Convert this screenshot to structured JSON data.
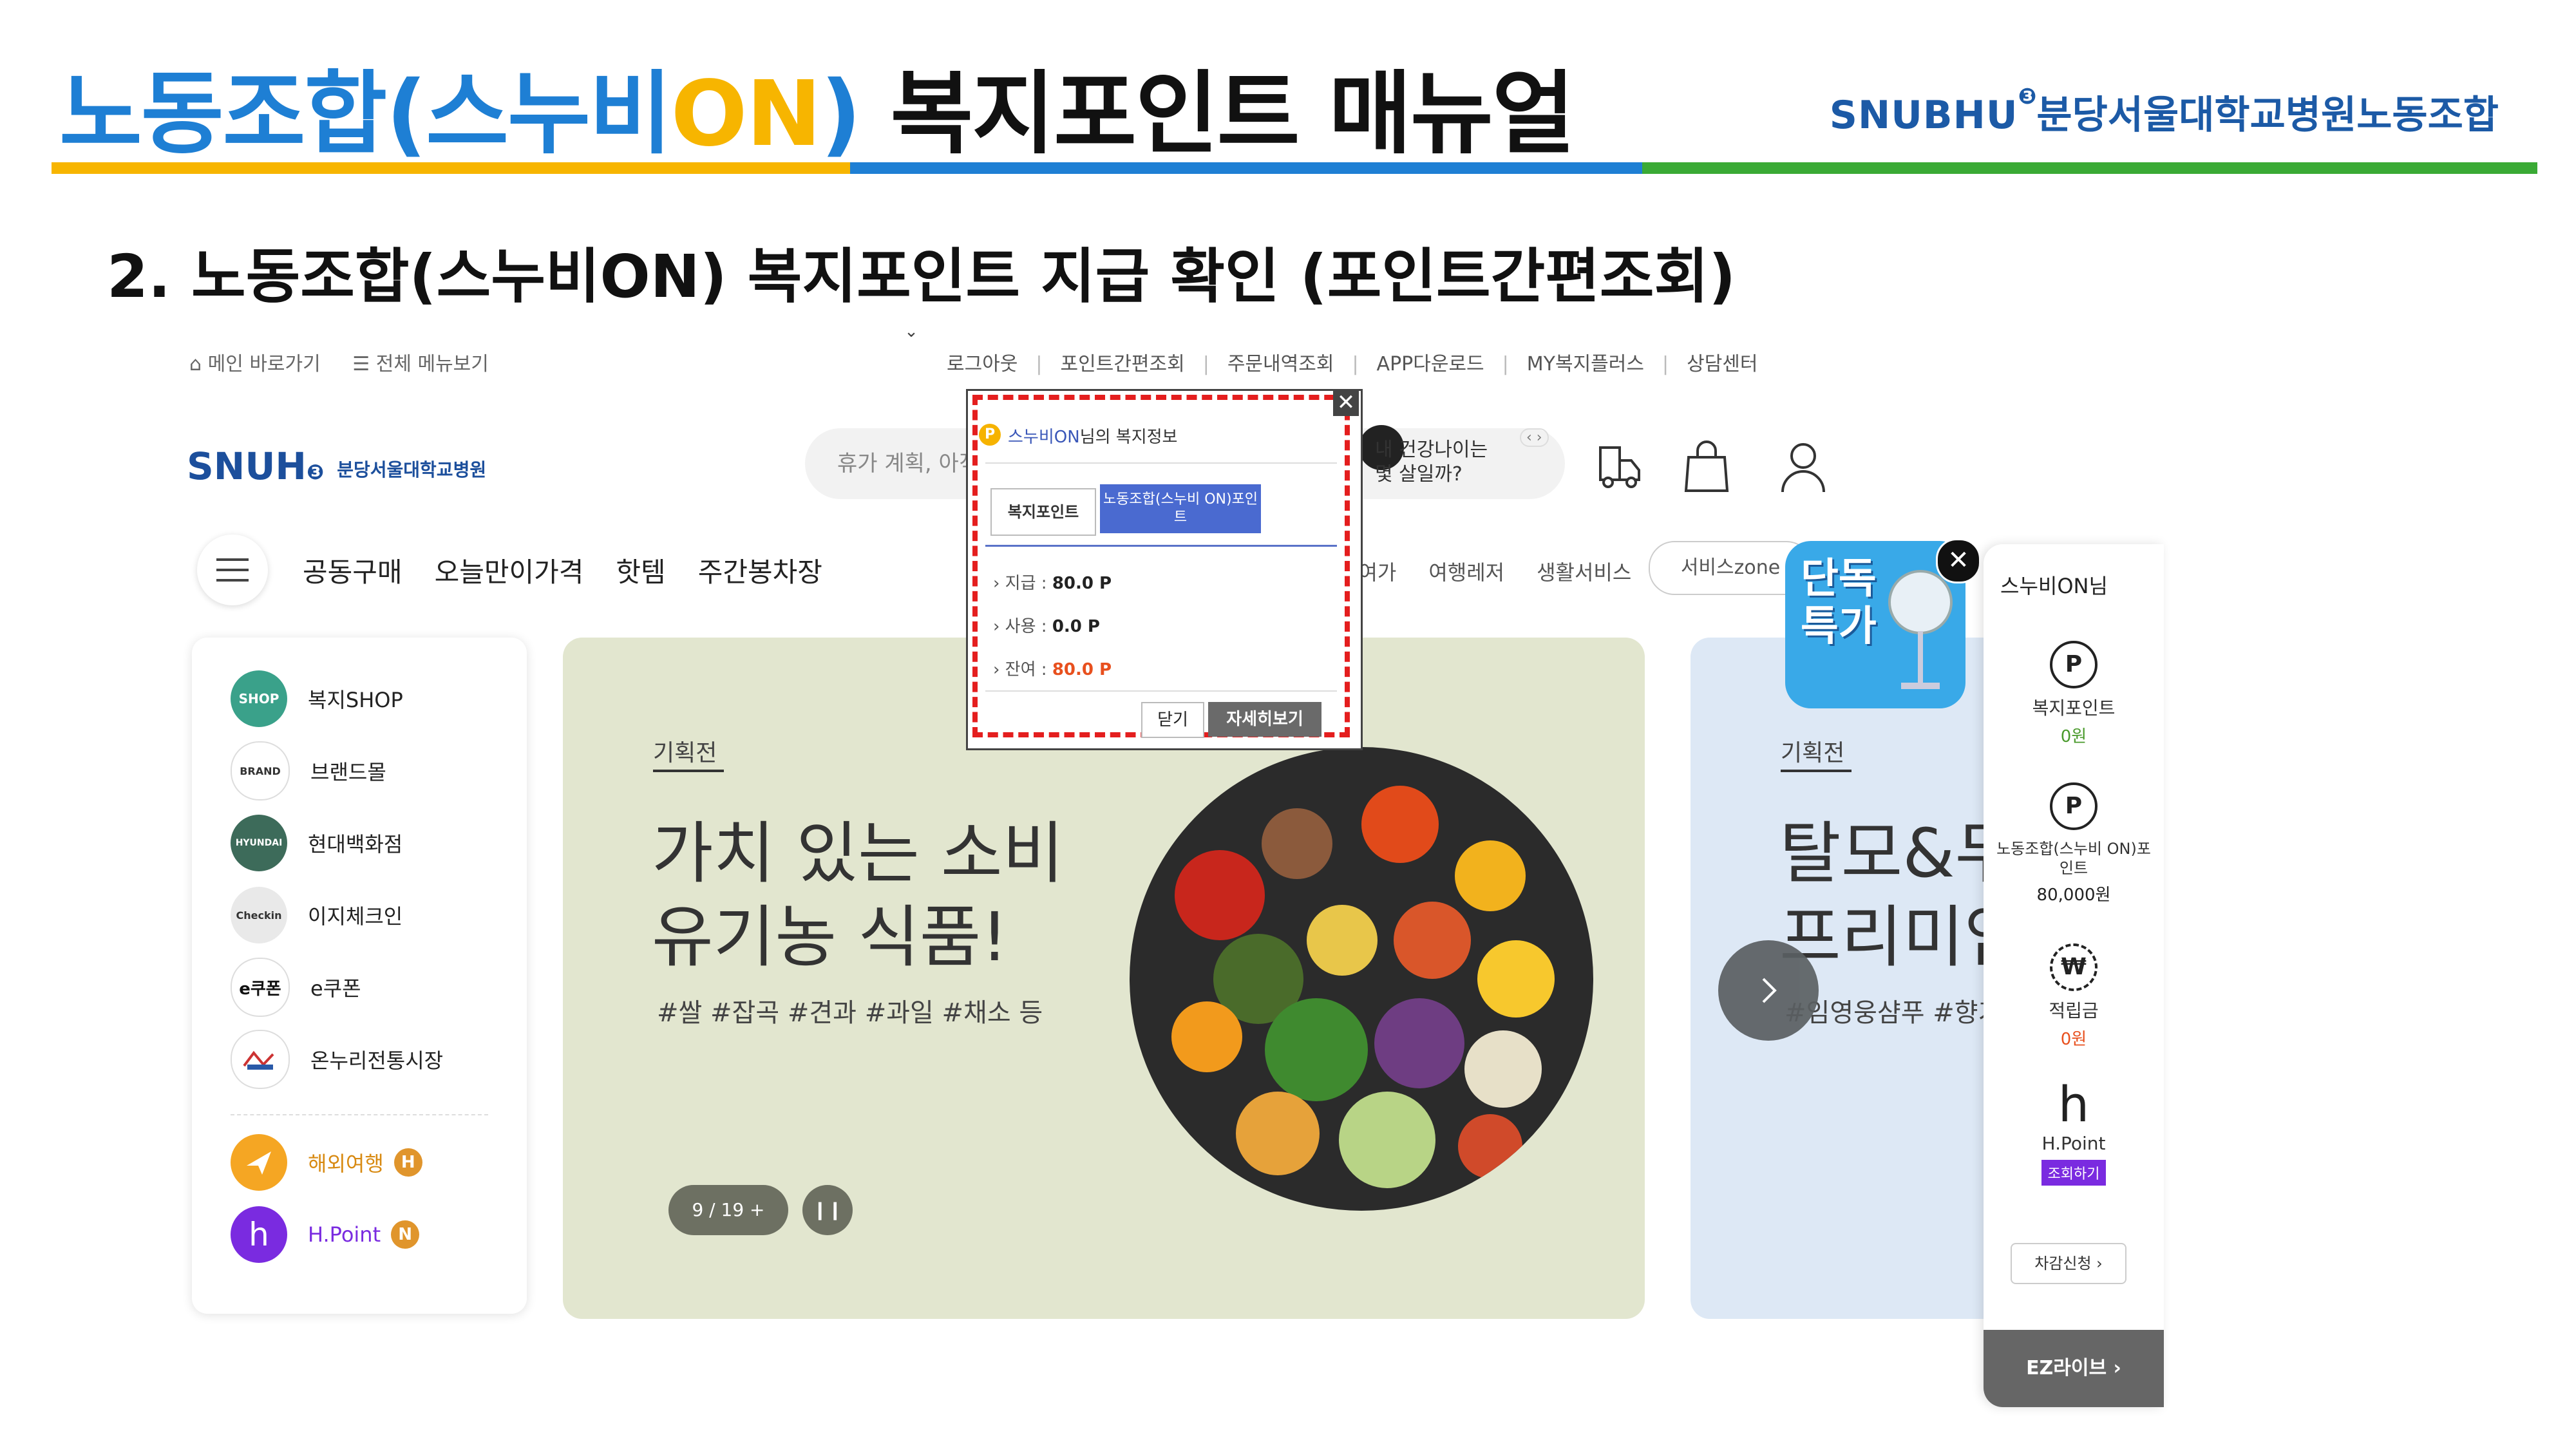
{
  "slide": {
    "title_part1": "노동조합(스누비",
    "title_part2": "ON",
    "title_part3": ")",
    "title_part4": "복지포인트 매뉴얼",
    "brand_logo": "SNUBHU",
    "brand_name": "분당서울대학교병원노동조합",
    "subtitle": "2. 노동조합(스누비ON) 복지포인트 지급 확인 (포인트간편조회)",
    "bar_colors": [
      "#f7b500",
      "#1e7fd4",
      "#3aaa35"
    ]
  },
  "site": {
    "top_left": {
      "home": "메인 바로가기",
      "all_menu": "전체 메뉴보기"
    },
    "top_links": [
      "로그아웃",
      "포인트간편조회",
      "주문내역조회",
      "APP다운로드",
      "MY복지플러스",
      "상담센터"
    ],
    "logo_text": "SNUH",
    "logo_sub": "분당서울대학교병원",
    "search_placeholder": "휴가 계획, 아직도? 물 좋은 강원도",
    "health_line1": "내 건강나이는",
    "health_line2": "몇 살일까?",
    "health_highlight": "건강나이",
    "nav_main": [
      "공동구매",
      "오늘만이가격",
      "핫템",
      "주간봉차장"
    ],
    "nav_sub": [
      "화여가",
      "여행레저",
      "생활서비스"
    ],
    "service_zone": "서비스zone"
  },
  "left_menu": [
    {
      "label": "복지SHOP",
      "icon": "shop-icon",
      "icon_text": "복지 SHOP",
      "color": "#3aa18a"
    },
    {
      "label": "브랜드몰",
      "icon": "brand-icon",
      "icon_text": "BRAND",
      "color": "#ffffff"
    },
    {
      "label": "현대백화점",
      "icon": "hyundai-icon",
      "icon_text": "HYUNDAI",
      "color": "#3d6b5a"
    },
    {
      "label": "이지체크인",
      "icon": "checkin-icon",
      "icon_text": "Checkin",
      "color": "#e9e9e9"
    },
    {
      "label": "e쿠폰",
      "icon": "ecoupon-icon",
      "icon_text": "e쿠폰",
      "color": "#ffffff"
    },
    {
      "label": "온누리전통시장",
      "icon": "market-icon",
      "icon_text": "",
      "color": "#ffffff"
    }
  ],
  "left_extra": [
    {
      "label": "해외여행",
      "badge": "H",
      "icon": "plane-icon",
      "color": "#f5a623"
    },
    {
      "label": "H.Point",
      "badge": "N",
      "icon": "hpoint-icon",
      "color": "#7a2be0"
    }
  ],
  "banner": {
    "tag": "기획전",
    "headline1": "가치 있는 소비",
    "headline2": "유기농 식품!",
    "hashtags": "#쌀 #잡곡 #견과 #과일 #채소 등",
    "pager": "9 / 19  +",
    "pause": "❙❙"
  },
  "banner2": {
    "tag": "기획전",
    "headline1": "탈모&두",
    "headline2": "프리미엄",
    "hashtags": "#임영웅샴푸 #향기"
  },
  "popup": {
    "title_name": "스누비ON",
    "title_rest": "님의 복지정보",
    "tab1": "복지포인트",
    "tab2": "노동조합(스누비 ON)포인트",
    "rows": [
      {
        "label": "지급 :",
        "value": "80.0 P"
      },
      {
        "label": "사용 :",
        "value": "0.0 P"
      },
      {
        "label": "잔여 :",
        "value": "80.0 P"
      }
    ],
    "btn_close": "닫기",
    "btn_more": "자세히보기",
    "close_x": "✕"
  },
  "promo": {
    "line1": "단독",
    "line2": "특가",
    "close": "✕"
  },
  "right_sidebar": {
    "user": "스누비ON님",
    "items": [
      {
        "label": "복지포인트",
        "value": "0원",
        "icon": "P"
      },
      {
        "label": "노동조합(스누비 ON)포인트",
        "value": "80,000원",
        "icon": "P"
      },
      {
        "label": "적립금",
        "value": "0원",
        "icon": "₩"
      },
      {
        "label": "H.Point",
        "value": "조회하기",
        "icon": "h"
      }
    ],
    "deduct": "차감신청  ›",
    "ezlive": "EZ라이브  ›"
  }
}
